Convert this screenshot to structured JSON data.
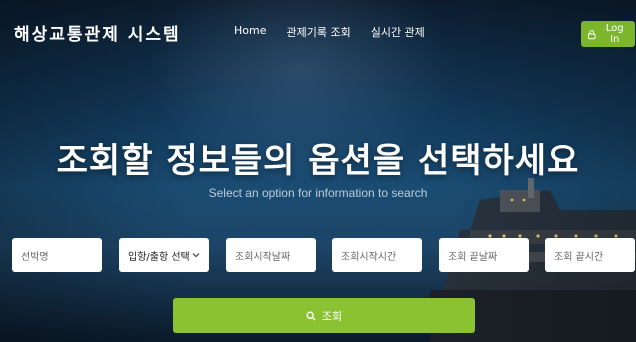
{
  "header": {
    "brand": "해상교통관제 시스템",
    "nav": [
      "Home",
      "관제기록 조회",
      "실시간 관제"
    ],
    "login_label": "Log In",
    "login_icon": "lock-icon"
  },
  "hero": {
    "title": "조회할 정보들의 옵션을 선택하세요",
    "subtitle": "Select an option for information to search"
  },
  "search_form": {
    "ship_name_placeholder": "선박명",
    "direction_select": {
      "selected": "입항/출항 선택",
      "icon": "chevron-down-icon"
    },
    "start_date_placeholder": "조회시작날짜",
    "start_time_placeholder": "조회시작시간",
    "end_date_placeholder": "조회 끝날짜",
    "end_time_placeholder": "조회 끝시간",
    "submit_label": "조회",
    "submit_icon": "search-icon"
  },
  "colors": {
    "accent": "#8ac232",
    "login_button": "#7bb62d",
    "background": "#123a5c"
  }
}
